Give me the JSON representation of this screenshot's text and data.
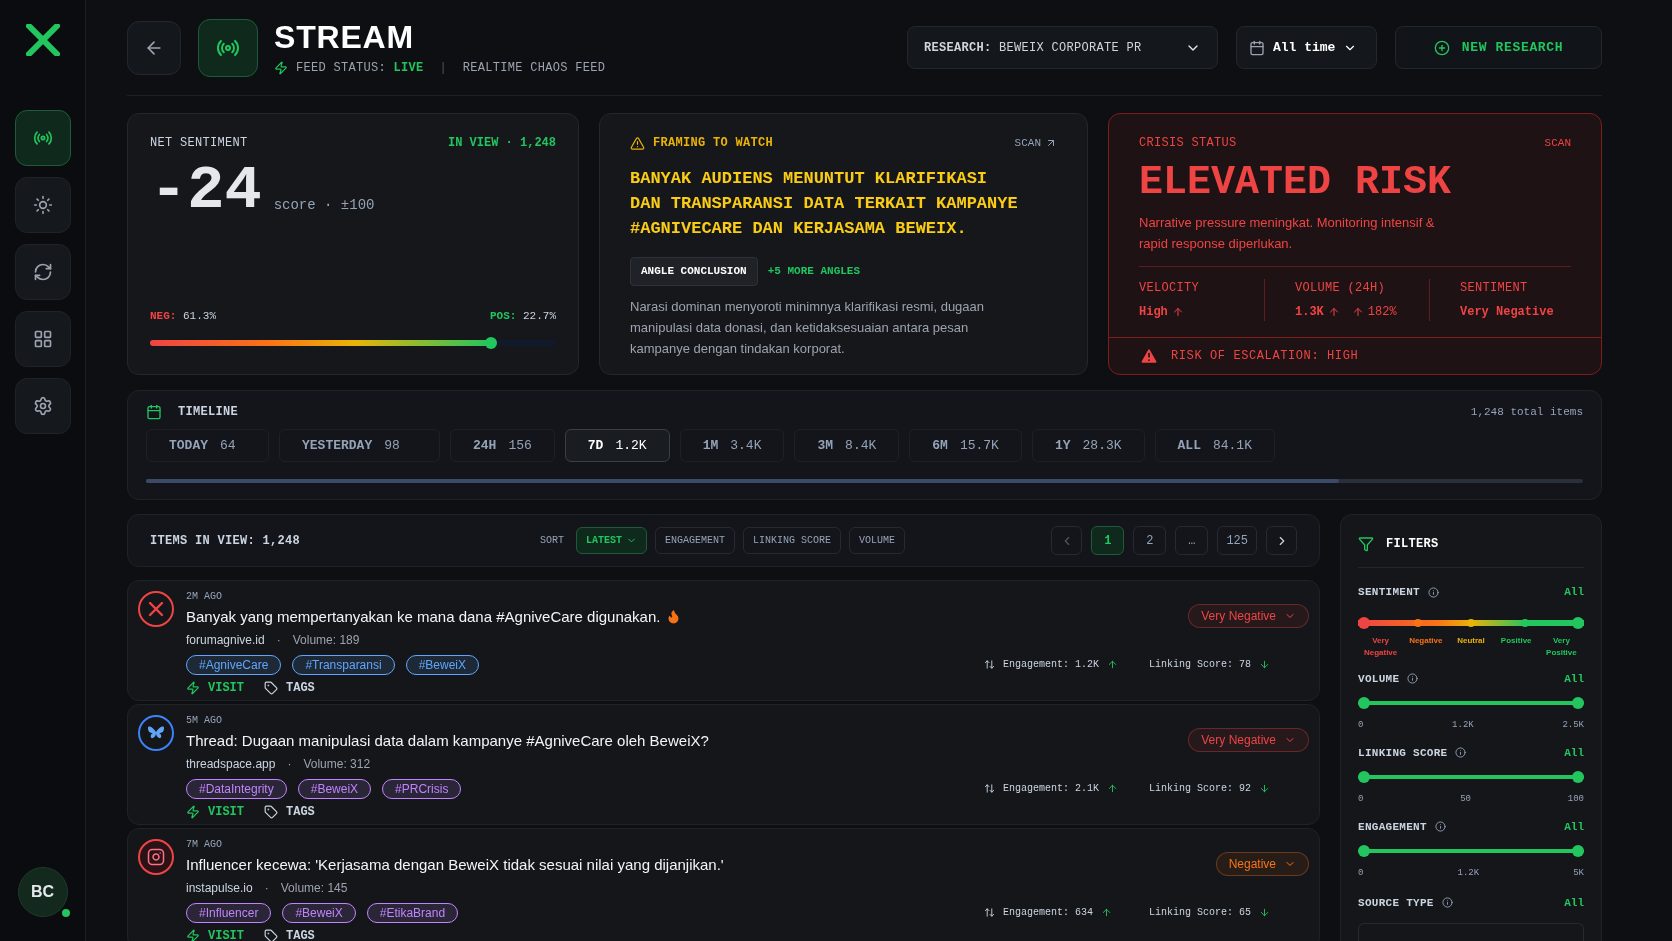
{
  "sidebar": {
    "items": [
      {
        "selected": true
      },
      {
        "selected": false
      },
      {
        "selected": false
      },
      {
        "selected": false
      },
      {
        "selected": false
      }
    ],
    "avatar": "BC",
    "online": true
  },
  "header": {
    "title": "STREAM",
    "feed_label": "FEED STATUS:",
    "feed_status": "LIVE",
    "separator": "|",
    "subtitle": "REALTIME CHAOS FEED",
    "research_label": "RESEARCH:",
    "research_value": "BEWEIX CORPORATE PR",
    "range": "All time",
    "new_research": "NEW RESEARCH"
  },
  "net_sentiment": {
    "title": "NET SENTIMENT",
    "in_view": "IN VIEW · 1,248",
    "score": "-24",
    "score_note": "score · ±100",
    "neg_label": "NEG:",
    "neg_value": "61.3%",
    "pos_label": "POS:",
    "pos_value": "22.7%",
    "level": 0.84
  },
  "framing": {
    "title": "FRAMING TO WATCH",
    "scan": "SCAN",
    "headline": "BANYAK AUDIENS MENUNTUT KLARIFIKASI DAN TRANSPARANSI DATA TERKAIT KAMPANYE #AGNIVECARE DAN KERJASAMA BEWEIX.",
    "angle": "ANGLE CONCLUSION",
    "more": "+5 MORE ANGLES",
    "body": "Narasi dominan menyoroti minimnya klarifikasi resmi, dugaan manipulasi data donasi, dan ketidaksesuaian antara pesan kampanye dengan tindakan korporat."
  },
  "crisis": {
    "title": "CRISIS STATUS",
    "scan": "SCAN",
    "status": "ELEVATED RISK",
    "body": "Narrative pressure meningkat. Monitoring intensif & rapid response diperlukan.",
    "metrics": [
      {
        "label": "VELOCITY",
        "value": "High",
        "rising": true
      },
      {
        "label": "VOLUME (24H)",
        "value": "1.3K",
        "rising": true,
        "extra": "182%"
      },
      {
        "label": "SENTIMENT",
        "value": "Very Negative",
        "rising": false
      }
    ],
    "escalation": "RISK OF ESCALATION: HIGH"
  },
  "timeline": {
    "title": "TIMELINE",
    "total": "1,248 total items",
    "level": 0.83,
    "tabs": [
      {
        "label": "TODAY",
        "count": "64",
        "selected": false
      },
      {
        "label": "YESTERDAY",
        "count": "98",
        "selected": false
      },
      {
        "label": "24H",
        "count": "156",
        "selected": false
      },
      {
        "label": "7D",
        "count": "1.2K",
        "selected": true
      },
      {
        "label": "1M",
        "count": "3.4K",
        "selected": false
      },
      {
        "label": "3M",
        "count": "8.4K",
        "selected": false
      },
      {
        "label": "6M",
        "count": "15.7K",
        "selected": false
      },
      {
        "label": "1Y",
        "count": "28.3K",
        "selected": false
      },
      {
        "label": "ALL",
        "count": "84.1K",
        "selected": false
      }
    ]
  },
  "items_bar": {
    "count": "ITEMS IN VIEW: 1,248",
    "sort_label": "SORT",
    "sorts": [
      {
        "label": "LATEST",
        "selected": true
      },
      {
        "label": "ENGAGEMENT",
        "selected": false
      },
      {
        "label": "LINKING SCORE",
        "selected": false
      },
      {
        "label": "VOLUME",
        "selected": false
      }
    ],
    "pages": [
      {
        "label": "1",
        "selected": true
      },
      {
        "label": "2",
        "selected": false
      },
      {
        "label": "…",
        "selected": false
      },
      {
        "label": "125",
        "selected": false
      }
    ]
  },
  "items": [
    {
      "kind": "x",
      "time": "2M AGO",
      "title": "Banyak yang mempertanyakan ke mana dana #AgniveCare digunakan.",
      "hot": true,
      "source": "forumagnive.id",
      "separator": "·",
      "volume": "Volume: 189",
      "sentiment": "Very Negative",
      "color": "#ef4444",
      "tags": [
        {
          "label": "#AgniveCare",
          "color": "#60a5fa"
        },
        {
          "label": "#Transparansi",
          "color": "#60a5fa"
        },
        {
          "label": "#BeweiX",
          "color": "#60a5fa"
        }
      ],
      "visit": "VISIT",
      "tags_label": "TAGS",
      "engagement": "Engagement: 1.2K",
      "linking": "Linking Score: 78"
    },
    {
      "kind": "butterfly",
      "time": "5M AGO",
      "title": "Thread: Dugaan manipulasi data dalam kampanye #AgniveCare oleh BeweiX?",
      "hot": false,
      "source": "threadspace.app",
      "separator": "·",
      "volume": "Volume: 312",
      "sentiment": "Very Negative",
      "color": "#ef4444",
      "tags": [
        {
          "label": "#DataIntegrity",
          "color": "#c084fc"
        },
        {
          "label": "#BeweiX",
          "color": "#c084fc"
        },
        {
          "label": "#PRCrisis",
          "color": "#c084fc"
        }
      ],
      "visit": "VISIT",
      "tags_label": "TAGS",
      "engagement": "Engagement: 2.1K",
      "linking": "Linking Score: 92"
    },
    {
      "kind": "camera",
      "time": "7M AGO",
      "title": "Influencer kecewa: 'Kerjasama dengan BeweiX tidak sesuai nilai yang dijanjikan.'",
      "hot": false,
      "source": "instapulse.io",
      "separator": "·",
      "volume": "Volume: 145",
      "sentiment": "Negative",
      "color": "#f97316",
      "tags": [
        {
          "label": "#Influencer",
          "color": "#c084fc"
        },
        {
          "label": "#BeweiX",
          "color": "#c084fc"
        },
        {
          "label": "#EtikaBrand",
          "color": "#c084fc"
        }
      ],
      "visit": "VISIT",
      "tags_label": "TAGS",
      "engagement": "Engagement: 634",
      "linking": "Linking Score: 65"
    }
  ],
  "filters": {
    "title": "FILTERS",
    "sentiment": {
      "label": "SENTIMENT",
      "all": "All",
      "scale": [
        {
          "label": "Very Negative",
          "color": "#ef4444"
        },
        {
          "label": "Negative",
          "color": "#f97316"
        },
        {
          "label": "Neutral",
          "color": "#eab308"
        },
        {
          "label": "Positive",
          "color": "#22c55e"
        },
        {
          "label": "Very Positive",
          "color": "#22c55e"
        }
      ]
    },
    "ranges": [
      {
        "label": "VOLUME",
        "all": "All",
        "level": 1,
        "ticks": [
          "0",
          "1.2K",
          "2.5K"
        ]
      },
      {
        "label": "LINKING SCORE",
        "all": "All",
        "level": 1,
        "ticks": [
          "0",
          "50",
          "100"
        ]
      },
      {
        "label": "ENGAGEMENT",
        "all": "All",
        "level": 1,
        "ticks": [
          "0",
          "1.2K",
          "5K"
        ]
      }
    ],
    "source_type": {
      "label": "SOURCE TYPE",
      "all": "All"
    }
  }
}
